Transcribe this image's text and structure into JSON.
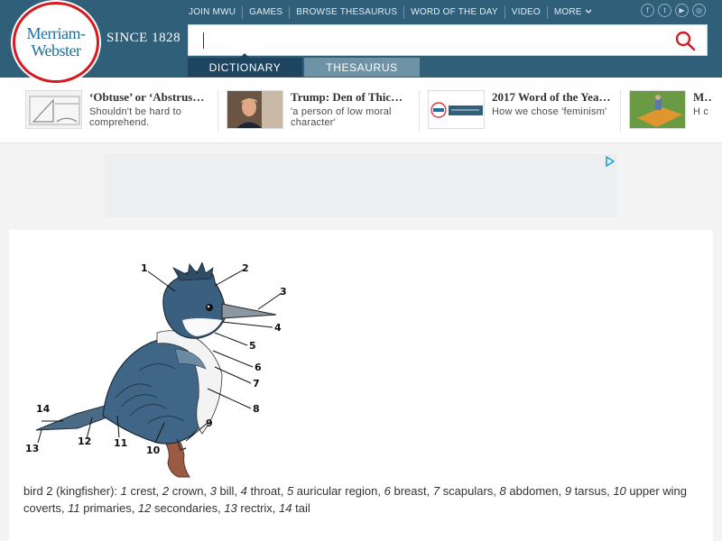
{
  "header": {
    "logo_line1": "Merriam-",
    "logo_line2": "Webster",
    "since": "SINCE 1828",
    "nav": [
      "JOIN MWU",
      "GAMES",
      "BROWSE THESAURUS",
      "WORD OF THE DAY",
      "VIDEO",
      "MORE"
    ],
    "social": [
      "facebook-icon",
      "twitter-icon",
      "youtube-icon",
      "instagram-icon"
    ],
    "search_value": "",
    "tabs": [
      "DICTIONARY",
      "THESAURUS"
    ]
  },
  "trending": [
    {
      "title": "‘Obtuse’ or ‘Abstrus…",
      "sub": "Shouldn't be hard to comprehend."
    },
    {
      "title": "Trump: Den of Thic…",
      "sub": "'a person of low moral character'"
    },
    {
      "title": "2017 Word of the Yea…",
      "sub": "How we chose 'feminism'"
    },
    {
      "title": "M…",
      "sub": "H c"
    }
  ],
  "figure": {
    "labels": [
      "1",
      "2",
      "3",
      "4",
      "5",
      "6",
      "7",
      "8",
      "9",
      "10",
      "11",
      "12",
      "13",
      "14"
    ]
  },
  "caption": {
    "prefix": "bird 2 (kingfisher): ",
    "parts": [
      {
        "n": "1",
        "t": " crest, "
      },
      {
        "n": "2",
        "t": " crown, "
      },
      {
        "n": "3",
        "t": " bill, "
      },
      {
        "n": "4",
        "t": " throat, "
      },
      {
        "n": "5",
        "t": " auricular region, "
      },
      {
        "n": "6",
        "t": " breast, "
      },
      {
        "n": "7",
        "t": " scapulars, "
      },
      {
        "n": "8",
        "t": " abdomen, "
      },
      {
        "n": "9",
        "t": " tarsus, "
      },
      {
        "n": "10",
        "t": " upper wing coverts, "
      },
      {
        "n": "11",
        "t": " primaries, "
      },
      {
        "n": "12",
        "t": " secondaries, "
      },
      {
        "n": "13",
        "t": " rectrix, "
      },
      {
        "n": "14",
        "t": " tail"
      }
    ]
  },
  "colors": {
    "header_bg": "#305f7a",
    "tab_active": "#1e4560",
    "tab_inactive": "#6f93a6",
    "logo_red": "#d71920",
    "logo_blue": "#1e6f9f"
  }
}
